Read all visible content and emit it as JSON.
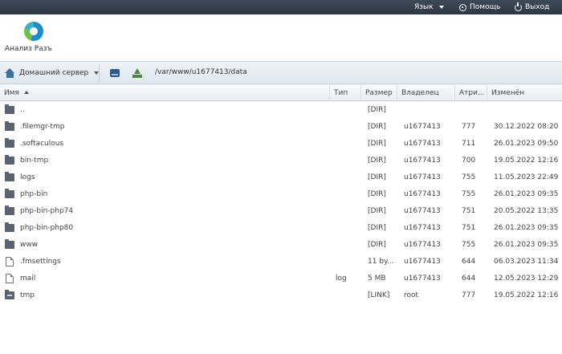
{
  "topbar": {
    "language": "Язык",
    "help": "Помощь",
    "exit": "Выход"
  },
  "header": {
    "app_label": "Анализ Разъ"
  },
  "toolbar": {
    "server": "Домашний сервер",
    "path": "/var/www/u1677413/data"
  },
  "columns": [
    "Имя",
    "Тип",
    "Размер",
    "Владелец",
    "Атри...",
    "Изменён"
  ],
  "rows": [
    {
      "icon": "folder",
      "name": "..",
      "type": "",
      "size": "[DIR]",
      "owner": "",
      "attr": "",
      "modified": ""
    },
    {
      "icon": "folder",
      "name": ".filemgr-tmp",
      "type": "",
      "size": "[DIR]",
      "owner": "u1677413",
      "attr": "777",
      "modified": "30.12.2022 08:20..."
    },
    {
      "icon": "folder",
      "name": ".softaculous",
      "type": "",
      "size": "[DIR]",
      "owner": "u1677413",
      "attr": "711",
      "modified": "26.01.2023 09:50..."
    },
    {
      "icon": "folder",
      "name": "bin-tmp",
      "type": "",
      "size": "[DIR]",
      "owner": "u1677413",
      "attr": "700",
      "modified": "19.05.2022 12:16..."
    },
    {
      "icon": "folder",
      "name": "logs",
      "type": "",
      "size": "[DIR]",
      "owner": "u1677413",
      "attr": "755",
      "modified": "11.05.2023 22:49..."
    },
    {
      "icon": "folder",
      "name": "php-bin",
      "type": "",
      "size": "[DIR]",
      "owner": "u1677413",
      "attr": "755",
      "modified": "26.01.2023 09:35..."
    },
    {
      "icon": "folder",
      "name": "php-bin-php74",
      "type": "",
      "size": "[DIR]",
      "owner": "u1677413",
      "attr": "751",
      "modified": "20.05.2022 13:35..."
    },
    {
      "icon": "folder",
      "name": "php-bin-php80",
      "type": "",
      "size": "[DIR]",
      "owner": "u1677413",
      "attr": "751",
      "modified": "26.01.2023 09:35..."
    },
    {
      "icon": "folder",
      "name": "www",
      "type": "",
      "size": "[DIR]",
      "owner": "u1677413",
      "attr": "755",
      "modified": "26.01.2023 09:35..."
    },
    {
      "icon": "file",
      "name": ".fmsettings",
      "type": "",
      "size": "11 by...",
      "owner": "u1677413",
      "attr": "644",
      "modified": "06.03.2023 11:34..."
    },
    {
      "icon": "file",
      "name": "mail",
      "type": "log",
      "size": "5 MB",
      "owner": "u1677413",
      "attr": "644",
      "modified": "12.05.2023 12:29..."
    },
    {
      "icon": "link",
      "name": "tmp",
      "type": "",
      "size": "[LINK]",
      "owner": "root",
      "attr": "777",
      "modified": "19.05.2022 12:16..."
    }
  ]
}
